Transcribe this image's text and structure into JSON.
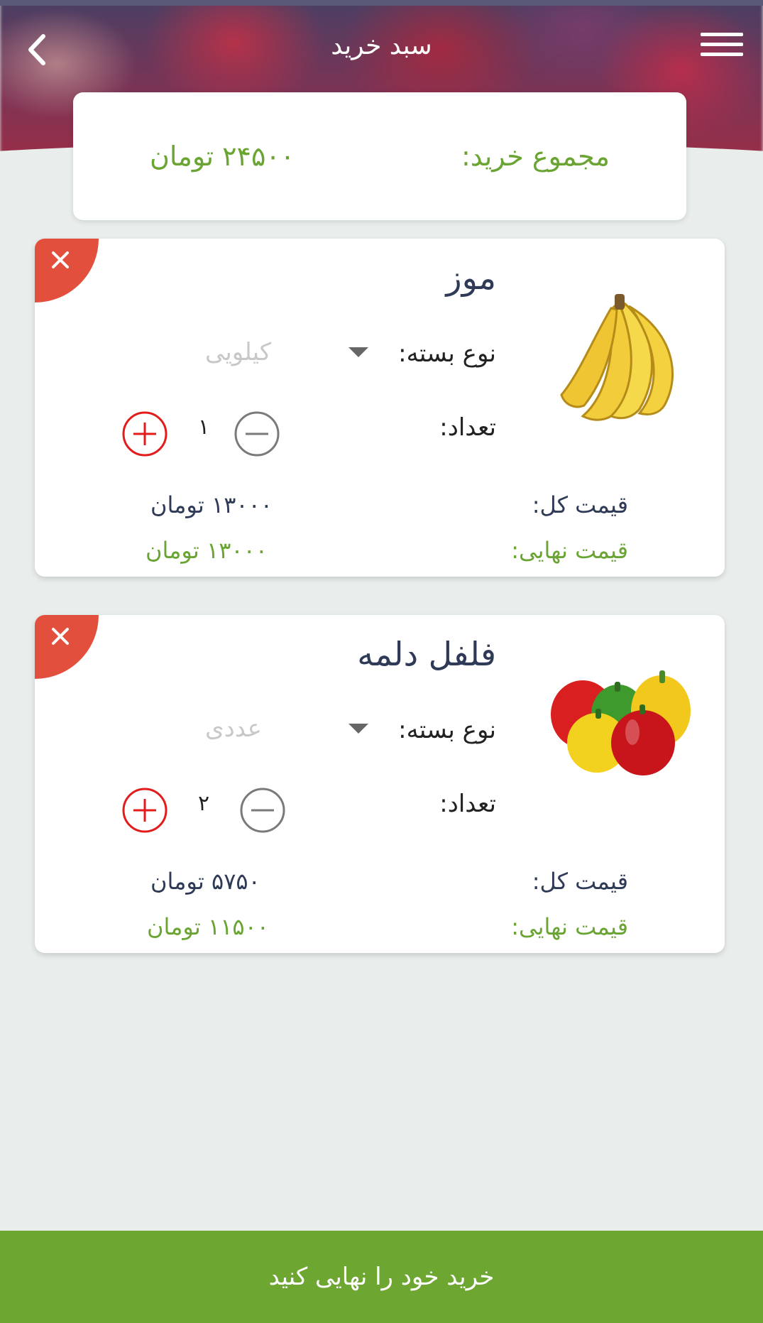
{
  "header": {
    "title": "سبد خرید",
    "back_icon": "chevron-left-icon",
    "menu_icon": "hamburger-menu-icon"
  },
  "summary": {
    "total_label": "مجموع خرید:",
    "total_value": "۲۴۵۰۰ تومان"
  },
  "items": [
    {
      "name": "موز",
      "image": "banana-image",
      "package_label": "نوع بسته:",
      "package_value": "کیلویی",
      "quantity_label": "تعداد:",
      "quantity": "۱",
      "total_price_label": "قیمت کل:",
      "total_price": "۱۳۰۰۰ تومان",
      "final_price_label": "قیمت نهایی:",
      "final_price": "۱۳۰۰۰ تومان"
    },
    {
      "name": "فلفل دلمه",
      "image": "bell-pepper-image",
      "package_label": "نوع بسته:",
      "package_value": "عددی",
      "quantity_label": "تعداد:",
      "quantity": "۲",
      "total_price_label": "قیمت کل:",
      "total_price": "۵۷۵۰ تومان",
      "final_price_label": "قیمت نهایی:",
      "final_price": "۱۱۵۰۰ تومان"
    }
  ],
  "footer": {
    "checkout_label": "خرید خود را نهایی کنید"
  },
  "colors": {
    "accent_green": "#6aa533",
    "remove_red": "#e34f3d",
    "plus_red": "#e21b1b"
  }
}
